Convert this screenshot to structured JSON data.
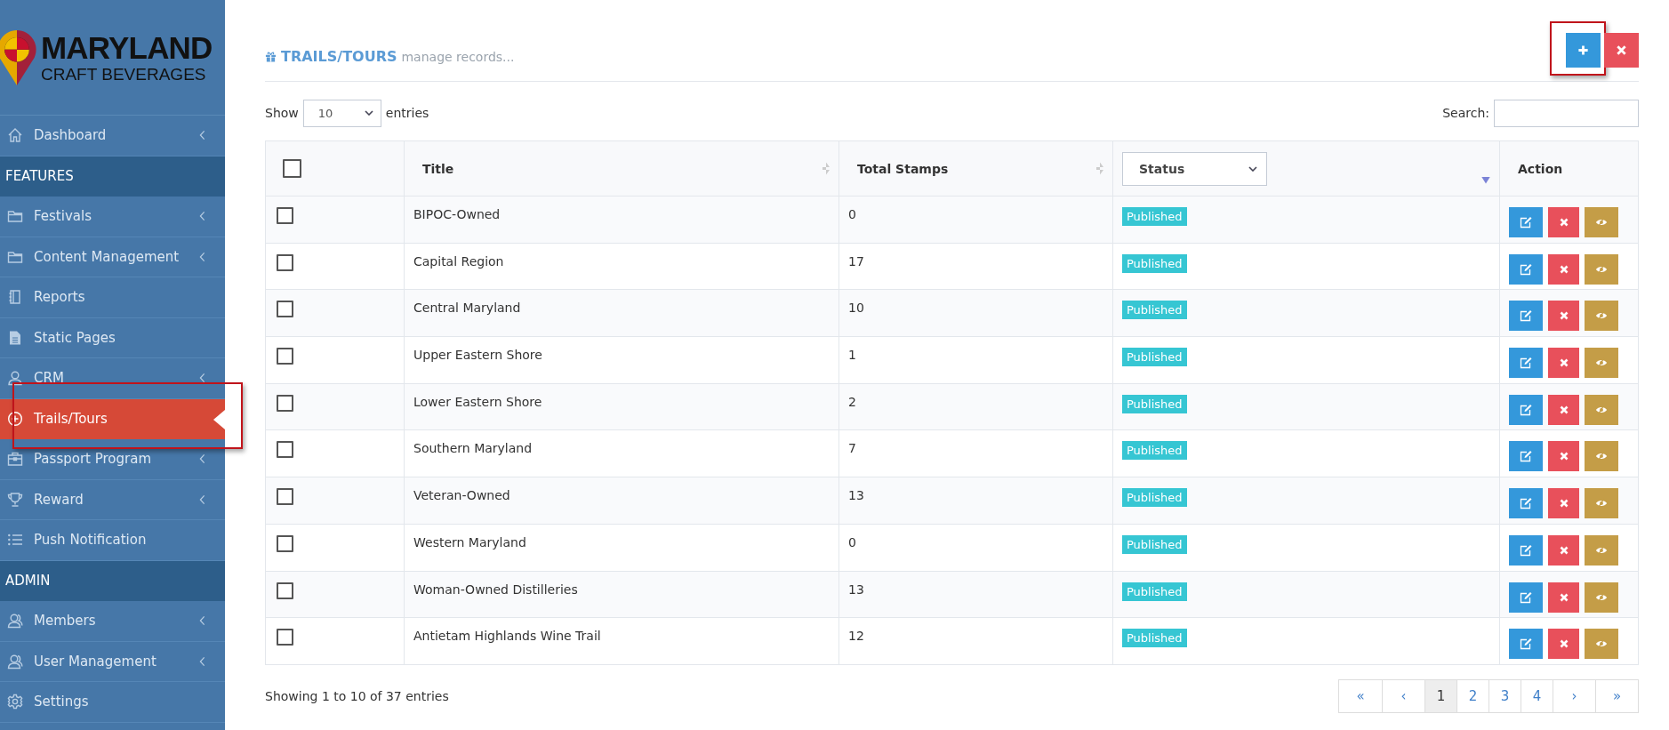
{
  "logo": {
    "title": "MARYLAND",
    "subtitle": "CRAFT BEVERAGES"
  },
  "sidebar": {
    "items": [
      {
        "kind": "link",
        "label": "Dashboard",
        "expandable": true,
        "selected": false,
        "highlighted": false
      },
      {
        "kind": "header",
        "label": "FEATURES"
      },
      {
        "kind": "link",
        "label": "Festivals",
        "expandable": true,
        "selected": false,
        "highlighted": false
      },
      {
        "kind": "link",
        "label": "Content Management",
        "expandable": true,
        "selected": false,
        "highlighted": false
      },
      {
        "kind": "link",
        "label": "Reports",
        "expandable": false,
        "selected": false,
        "highlighted": false
      },
      {
        "kind": "link",
        "label": "Static Pages",
        "expandable": false,
        "selected": false,
        "highlighted": false
      },
      {
        "kind": "link",
        "label": "CRM",
        "expandable": true,
        "selected": false,
        "highlighted": false
      },
      {
        "kind": "link",
        "label": "Trails/Tours",
        "expandable": false,
        "selected": true,
        "highlighted": true
      },
      {
        "kind": "link",
        "label": "Passport Program",
        "expandable": true,
        "selected": false,
        "highlighted": false
      },
      {
        "kind": "link",
        "label": "Reward",
        "expandable": true,
        "selected": false,
        "highlighted": false
      },
      {
        "kind": "link",
        "label": "Push Notification",
        "expandable": false,
        "selected": false,
        "highlighted": false
      },
      {
        "kind": "header",
        "label": "ADMIN"
      },
      {
        "kind": "link",
        "label": "Members",
        "expandable": true,
        "selected": false,
        "highlighted": false
      },
      {
        "kind": "link",
        "label": "User Management",
        "expandable": true,
        "selected": false,
        "highlighted": false
      },
      {
        "kind": "link",
        "label": "Settings",
        "expandable": false,
        "selected": false,
        "highlighted": false
      }
    ]
  },
  "page_header": {
    "title": "TRAILS/TOURS",
    "subtitle": "manage records...",
    "add_button": {
      "highlighted": true
    }
  },
  "length_control": {
    "label_before": "Show",
    "value": "10",
    "label_after": "entries"
  },
  "search": {
    "label": "Search:"
  },
  "table": {
    "select_all": {
      "checked": false
    },
    "columns": [
      {
        "label": "Title",
        "kind": "sortable"
      },
      {
        "label": "Total Stamps",
        "kind": "sortable"
      },
      {
        "label": "Status",
        "kind": "filter"
      },
      {
        "label": "Action",
        "kind": "plain"
      }
    ],
    "rows": [
      {
        "checked": false,
        "title": "BIPOC-Owned",
        "total_stamps": "0",
        "status": "Published"
      },
      {
        "checked": false,
        "title": "Capital Region",
        "total_stamps": "17",
        "status": "Published"
      },
      {
        "checked": false,
        "title": "Central Maryland",
        "total_stamps": "10",
        "status": "Published"
      },
      {
        "checked": false,
        "title": "Upper Eastern Shore",
        "total_stamps": "1",
        "status": "Published"
      },
      {
        "checked": false,
        "title": "Lower Eastern Shore",
        "total_stamps": "2",
        "status": "Published"
      },
      {
        "checked": false,
        "title": "Southern Maryland",
        "total_stamps": "7",
        "status": "Published"
      },
      {
        "checked": false,
        "title": "Veteran-Owned",
        "total_stamps": "13",
        "status": "Published"
      },
      {
        "checked": false,
        "title": "Western Maryland",
        "total_stamps": "0",
        "status": "Published"
      },
      {
        "checked": false,
        "title": "Woman-Owned Distilleries",
        "total_stamps": "13",
        "status": "Published"
      },
      {
        "checked": false,
        "title": "Antietam Highlands Wine Trail",
        "total_stamps": "12",
        "status": "Published"
      }
    ]
  },
  "table_info": "Showing 1 to 10 of 37 entries",
  "pagination": [
    {
      "label": "«",
      "selected": false
    },
    {
      "label": "‹",
      "selected": false
    },
    {
      "label": "1",
      "selected": true
    },
    {
      "label": "2",
      "selected": false
    },
    {
      "label": "3",
      "selected": false
    },
    {
      "label": "4",
      "selected": false
    },
    {
      "label": "›",
      "selected": false
    },
    {
      "label": "»",
      "selected": false
    }
  ]
}
